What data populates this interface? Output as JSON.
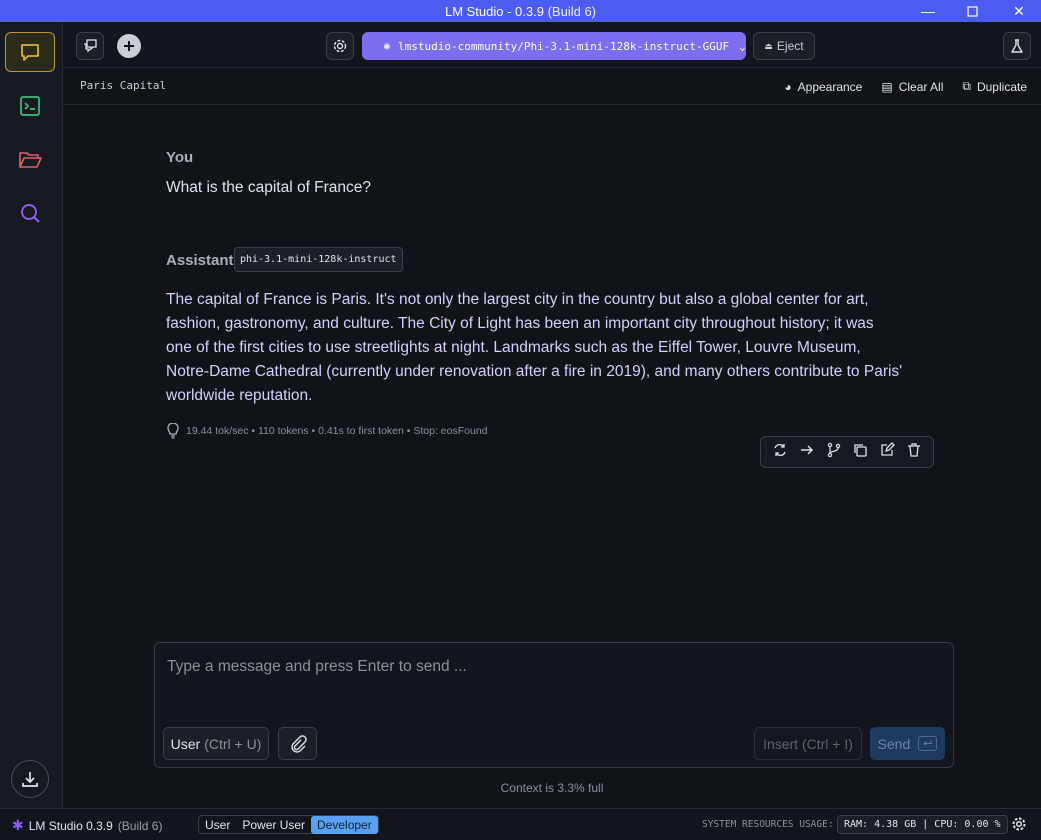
{
  "window": {
    "title": "LM Studio - 0.3.9",
    "build": "(Build 6)"
  },
  "topbar": {
    "model": "lmstudio-community/Phi-3.1-mini-128k-instruct-GGUF",
    "eject": "Eject"
  },
  "chat": {
    "title": "Paris Capital",
    "actions": {
      "appearance": "Appearance",
      "clear": "Clear All",
      "duplicate": "Duplicate"
    }
  },
  "messages": {
    "user_role": "You",
    "user_text": "What is the capital of France?",
    "assistant_role": "Assistant",
    "assistant_model": "phi-3.1-mini-128k-instruct",
    "assistant_lines": [
      "The capital of France is Paris. It's not only the largest city in the country but also a global center for art,",
      "fashion, gastronomy, and culture. The City of Light has been an important city throughout history; it was",
      "one of the first cities to use streetlights at night. Landmarks such as the Eiffel Tower, Louvre Museum,",
      "Notre-Dame Cathedral (currently under renovation after a fire in 2019), and many others contribute to Paris'",
      "worldwide reputation."
    ],
    "stats": "19.44 tok/sec • 110 tokens • 0.41s to first token • Stop: eosFound"
  },
  "composer": {
    "placeholder": "Type a message and press Enter to send ...",
    "user_label": "User",
    "user_hint": "(Ctrl + U)",
    "insert": "Insert (Ctrl + I)",
    "send": "Send"
  },
  "context": "Context is 3.3% full",
  "statusbar": {
    "app": "LM Studio 0.3.9",
    "build": "(Build 6)",
    "modes": [
      "User",
      "Power User",
      "Developer"
    ],
    "resources_label": "SYSTEM RESOURCES USAGE:",
    "resources": "RAM: 4.38 GB | CPU: 0.00 %"
  },
  "colors": {
    "accent": "#4a5df0",
    "model_pill": "#7b6ff0",
    "developer_mode": "#5aa0f0"
  }
}
